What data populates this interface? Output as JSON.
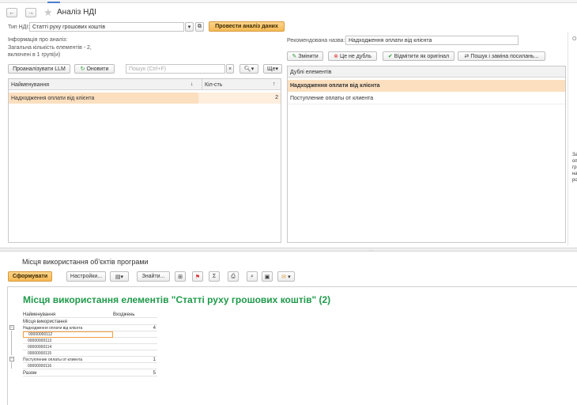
{
  "window": {
    "title": "Аналіз НДІ",
    "star_icon": "star-icon"
  },
  "top": {
    "type_label": "Тип НДІ:",
    "type_value": "Статті руху грошових коштів",
    "run_button": "Провести аналіз даних",
    "info_line1": "Інформація про аналіз:",
    "info_line2": "Загальна кількість елементів - 2,",
    "info_line3": "включені в 1 групі(и)"
  },
  "left_toolbar": {
    "analyze_llm": "Проаналізувати LLM",
    "refresh": "Оновити",
    "search_placeholder": "Пошук (Ctrl+F)",
    "more": "Ще"
  },
  "left_grid": {
    "col_name": "Найменування",
    "col_count": "Кіл-сть",
    "rows": [
      {
        "name": "Надходження оплати від клієнта",
        "count": "2"
      }
    ]
  },
  "right": {
    "rec_label": "Рекомендована назва:",
    "rec_value": "Надходження оплати від клієнта",
    "btn_change": "Змінити",
    "btn_not_dup": "Це не дубль",
    "btn_mark_orig": "Відмітити як оригінал",
    "btn_search_replace": "Пошук і заміна посилань...",
    "grid_header": "Дублі елементів",
    "rows": [
      "Надходження оплати від клієнта",
      "Поступление оплаты от клиента"
    ]
  },
  "edge_text": {
    "top": "О",
    "lines": [
      "За",
      "оп",
      "гр",
      "на",
      "ро"
    ]
  },
  "bottom": {
    "title": "Місця використання об'єктів програми",
    "btn_generate": "Сформувати",
    "btn_settings": "Настройки...",
    "btn_find": "Знайти...",
    "report_title": "Місця використання елементів \"Статті руху грошових коштів\" (2)",
    "col_name": "Найменування",
    "col_entries": "Входжень",
    "subheader": "Місця використання",
    "rows": [
      {
        "name": "Надходження оплати від клієнта",
        "value": "4",
        "level": 0
      },
      {
        "name": "00000000112",
        "value": "",
        "level": 1
      },
      {
        "name": "00000000113",
        "value": "",
        "level": 1
      },
      {
        "name": "00000000114",
        "value": "",
        "level": 1
      },
      {
        "name": "00000000115",
        "value": "",
        "level": 1
      },
      {
        "name": "Поступление оплаты от клиента",
        "value": "1",
        "level": 0
      },
      {
        "name": "00000000116",
        "value": "",
        "level": 1
      }
    ],
    "total_label": "Разом",
    "total_value": "5"
  },
  "colors": {
    "accent": "#f5b955",
    "selection": "#fbdfbf",
    "report_title": "#1f9a4a"
  }
}
